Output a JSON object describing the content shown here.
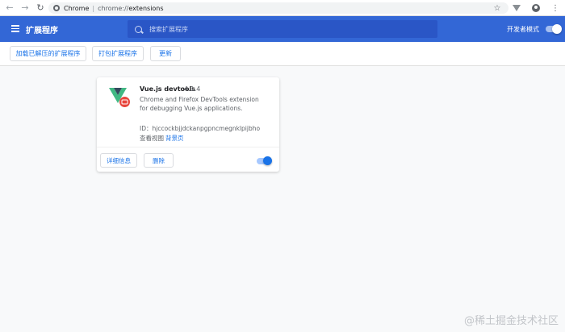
{
  "browser": {
    "address_scheme": "Chrome",
    "address_separator": "|",
    "address_prefix": "chrome://",
    "address_path": "extensions",
    "nav_icons": [
      "back-arrow-icon",
      "forward-arrow-icon",
      "reload-icon"
    ],
    "right_icons": [
      "star-icon",
      "vue-devtools-icon",
      "profile-icon",
      "more-vert-icon"
    ]
  },
  "toolbar": {
    "title": "扩展程序",
    "search_placeholder": "搜索扩展程序",
    "devmode_label": "开发者模式",
    "devmode_on": true,
    "accent_color": "#3367d6"
  },
  "actions": {
    "load_unpacked": "加载已解压的扩展程序",
    "pack": "打包扩展程序",
    "update": "更新"
  },
  "extension": {
    "name": "Vue.js devtools",
    "version": "4.1.4",
    "description": "Chrome and Firefox DevTools extension for debugging Vue.js applications.",
    "id_label": "ID：",
    "id_value": "hjccockbjjdckanpgpncmegnklpijbho",
    "views_label": "查看视图",
    "views_link": "背景页",
    "details_button": "详细信息",
    "remove_button": "删除",
    "enabled": true
  },
  "watermark": "@稀土掘金技术社区"
}
